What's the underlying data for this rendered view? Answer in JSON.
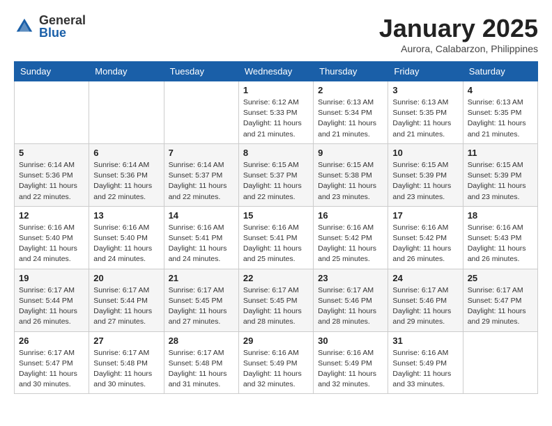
{
  "header": {
    "logo_general": "General",
    "logo_blue": "Blue",
    "month": "January 2025",
    "location": "Aurora, Calabarzon, Philippines"
  },
  "days_of_week": [
    "Sunday",
    "Monday",
    "Tuesday",
    "Wednesday",
    "Thursday",
    "Friday",
    "Saturday"
  ],
  "weeks": [
    [
      {
        "day": "",
        "info": ""
      },
      {
        "day": "",
        "info": ""
      },
      {
        "day": "",
        "info": ""
      },
      {
        "day": "1",
        "info": "Sunrise: 6:12 AM\nSunset: 5:33 PM\nDaylight: 11 hours\nand 21 minutes."
      },
      {
        "day": "2",
        "info": "Sunrise: 6:13 AM\nSunset: 5:34 PM\nDaylight: 11 hours\nand 21 minutes."
      },
      {
        "day": "3",
        "info": "Sunrise: 6:13 AM\nSunset: 5:35 PM\nDaylight: 11 hours\nand 21 minutes."
      },
      {
        "day": "4",
        "info": "Sunrise: 6:13 AM\nSunset: 5:35 PM\nDaylight: 11 hours\nand 21 minutes."
      }
    ],
    [
      {
        "day": "5",
        "info": "Sunrise: 6:14 AM\nSunset: 5:36 PM\nDaylight: 11 hours\nand 22 minutes."
      },
      {
        "day": "6",
        "info": "Sunrise: 6:14 AM\nSunset: 5:36 PM\nDaylight: 11 hours\nand 22 minutes."
      },
      {
        "day": "7",
        "info": "Sunrise: 6:14 AM\nSunset: 5:37 PM\nDaylight: 11 hours\nand 22 minutes."
      },
      {
        "day": "8",
        "info": "Sunrise: 6:15 AM\nSunset: 5:37 PM\nDaylight: 11 hours\nand 22 minutes."
      },
      {
        "day": "9",
        "info": "Sunrise: 6:15 AM\nSunset: 5:38 PM\nDaylight: 11 hours\nand 23 minutes."
      },
      {
        "day": "10",
        "info": "Sunrise: 6:15 AM\nSunset: 5:39 PM\nDaylight: 11 hours\nand 23 minutes."
      },
      {
        "day": "11",
        "info": "Sunrise: 6:15 AM\nSunset: 5:39 PM\nDaylight: 11 hours\nand 23 minutes."
      }
    ],
    [
      {
        "day": "12",
        "info": "Sunrise: 6:16 AM\nSunset: 5:40 PM\nDaylight: 11 hours\nand 24 minutes."
      },
      {
        "day": "13",
        "info": "Sunrise: 6:16 AM\nSunset: 5:40 PM\nDaylight: 11 hours\nand 24 minutes."
      },
      {
        "day": "14",
        "info": "Sunrise: 6:16 AM\nSunset: 5:41 PM\nDaylight: 11 hours\nand 24 minutes."
      },
      {
        "day": "15",
        "info": "Sunrise: 6:16 AM\nSunset: 5:41 PM\nDaylight: 11 hours\nand 25 minutes."
      },
      {
        "day": "16",
        "info": "Sunrise: 6:16 AM\nSunset: 5:42 PM\nDaylight: 11 hours\nand 25 minutes."
      },
      {
        "day": "17",
        "info": "Sunrise: 6:16 AM\nSunset: 5:42 PM\nDaylight: 11 hours\nand 26 minutes."
      },
      {
        "day": "18",
        "info": "Sunrise: 6:16 AM\nSunset: 5:43 PM\nDaylight: 11 hours\nand 26 minutes."
      }
    ],
    [
      {
        "day": "19",
        "info": "Sunrise: 6:17 AM\nSunset: 5:44 PM\nDaylight: 11 hours\nand 26 minutes."
      },
      {
        "day": "20",
        "info": "Sunrise: 6:17 AM\nSunset: 5:44 PM\nDaylight: 11 hours\nand 27 minutes."
      },
      {
        "day": "21",
        "info": "Sunrise: 6:17 AM\nSunset: 5:45 PM\nDaylight: 11 hours\nand 27 minutes."
      },
      {
        "day": "22",
        "info": "Sunrise: 6:17 AM\nSunset: 5:45 PM\nDaylight: 11 hours\nand 28 minutes."
      },
      {
        "day": "23",
        "info": "Sunrise: 6:17 AM\nSunset: 5:46 PM\nDaylight: 11 hours\nand 28 minutes."
      },
      {
        "day": "24",
        "info": "Sunrise: 6:17 AM\nSunset: 5:46 PM\nDaylight: 11 hours\nand 29 minutes."
      },
      {
        "day": "25",
        "info": "Sunrise: 6:17 AM\nSunset: 5:47 PM\nDaylight: 11 hours\nand 29 minutes."
      }
    ],
    [
      {
        "day": "26",
        "info": "Sunrise: 6:17 AM\nSunset: 5:47 PM\nDaylight: 11 hours\nand 30 minutes."
      },
      {
        "day": "27",
        "info": "Sunrise: 6:17 AM\nSunset: 5:48 PM\nDaylight: 11 hours\nand 30 minutes."
      },
      {
        "day": "28",
        "info": "Sunrise: 6:17 AM\nSunset: 5:48 PM\nDaylight: 11 hours\nand 31 minutes."
      },
      {
        "day": "29",
        "info": "Sunrise: 6:16 AM\nSunset: 5:49 PM\nDaylight: 11 hours\nand 32 minutes."
      },
      {
        "day": "30",
        "info": "Sunrise: 6:16 AM\nSunset: 5:49 PM\nDaylight: 11 hours\nand 32 minutes."
      },
      {
        "day": "31",
        "info": "Sunrise: 6:16 AM\nSunset: 5:49 PM\nDaylight: 11 hours\nand 33 minutes."
      },
      {
        "day": "",
        "info": ""
      }
    ]
  ]
}
